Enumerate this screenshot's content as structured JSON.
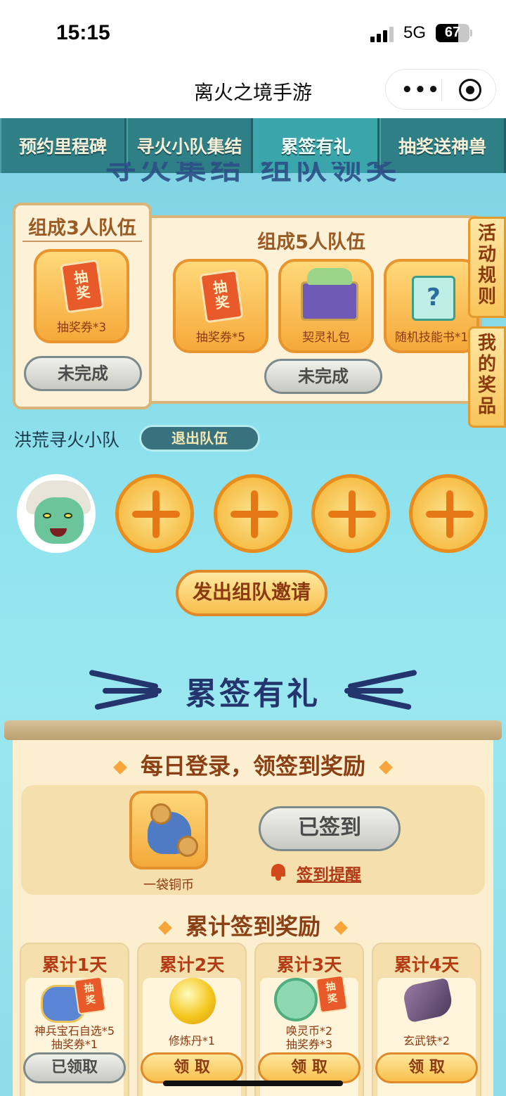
{
  "status_bar": {
    "time": "15:15",
    "network": "5G",
    "battery": "67"
  },
  "title_bar": {
    "title": "离火之境手游",
    "more_icon": "more-dots-icon",
    "close_icon": "target-icon"
  },
  "tabs": [
    {
      "label": "预约里程碑"
    },
    {
      "label": "寻火小队集结"
    },
    {
      "label": "累签有礼",
      "active": true
    },
    {
      "label": "抽奖送神兽"
    }
  ],
  "banner_text": "寻火集结 组队领奖",
  "team3": {
    "title": "组成3人队伍",
    "reward": {
      "label": "抽奖券*3",
      "icon_text": "抽\n奖"
    },
    "status": "未完成"
  },
  "team5": {
    "title": "组成5人队伍",
    "rewards": [
      {
        "label": "抽奖券*5",
        "icon_text": "抽\n奖"
      },
      {
        "label": "契灵礼包"
      },
      {
        "label": "随机技能书*1",
        "icon_text": "?"
      }
    ],
    "status": "未完成"
  },
  "side_buttons": {
    "rules": "活动规则",
    "prizes": "我的奖品"
  },
  "team": {
    "name": "洪荒寻火小队",
    "quit_label": "退出队伍",
    "empty_slots": 4
  },
  "invite_label": "发出组队邀请",
  "signin_section": {
    "title": "累签有礼",
    "daily_title": "每日登录，领签到奖励",
    "daily_reward": "一袋铜币",
    "signed_label": "已签到",
    "remind_label": "签到提醒",
    "cumulative_title": "累计签到奖励",
    "days": [
      {
        "title": "累计1天",
        "rewards": "神兵宝石自选*5\n抽奖券*1",
        "button": "已领取",
        "claimed": true
      },
      {
        "title": "累计2天",
        "rewards": "修炼丹*1",
        "button": "领 取",
        "claimed": false
      },
      {
        "title": "累计3天",
        "rewards": "唤灵币*2\n抽奖券*3",
        "button": "领 取",
        "claimed": false
      },
      {
        "title": "累计4天",
        "rewards": "玄武铁*2",
        "button": "领 取",
        "claimed": false
      }
    ]
  },
  "colors": {
    "tab_bg": "#2f7f86",
    "page_bg": "#8fe3ee",
    "accent_orange": "#e98c1e",
    "title_navy": "#24356e"
  }
}
